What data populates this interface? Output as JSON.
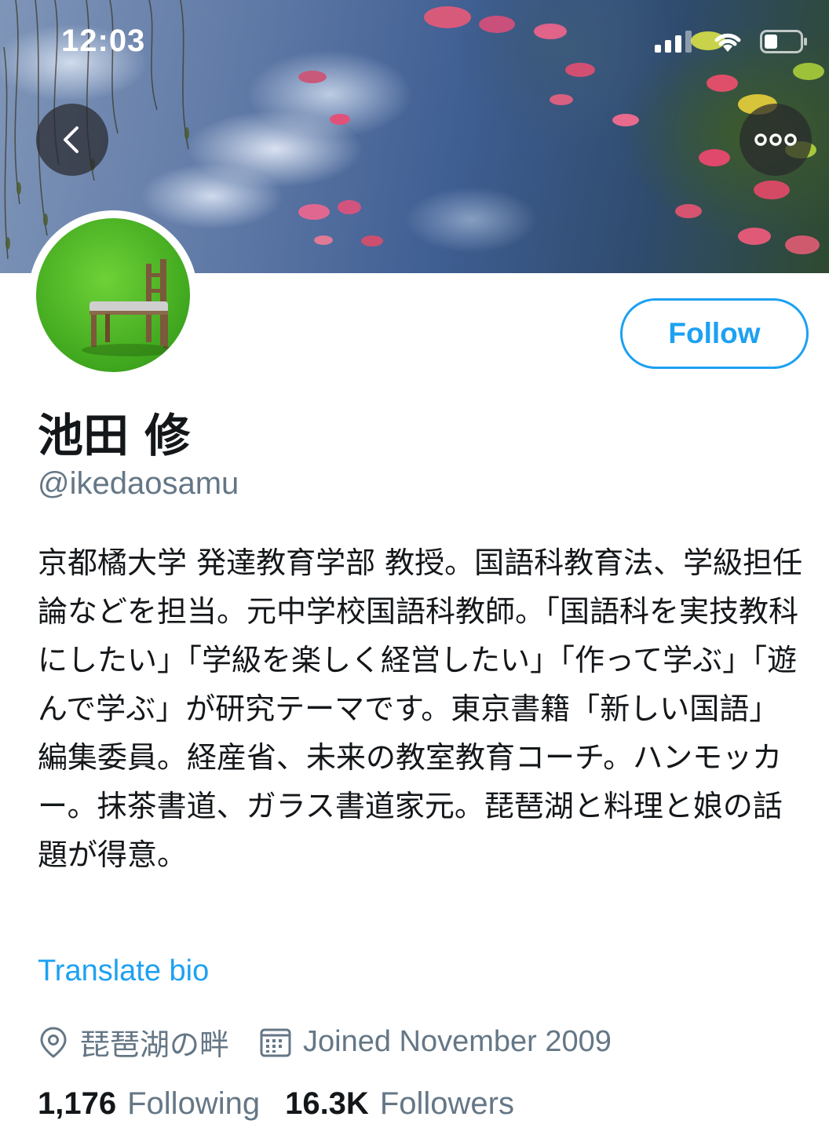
{
  "status_bar": {
    "time": "12:03"
  },
  "header": {
    "back_icon": "chevron-left-icon",
    "more_icon": "ellipsis-icon"
  },
  "profile": {
    "display_name": "池田 修",
    "handle": "@ikedaosamu",
    "follow_label": "Follow",
    "bio": "京都橘大学 発達教育学部 教授。国語科教育法、学級担任論などを担当。元中学校国語科教師。「国語科を実技教科にしたい」「学級を楽しく経営したい」「作って学ぶ」「遊んで学ぶ」が研究テーマです。東京書籍「新しい国語」編集委員。経産省、未来の教室教育コーチ。ハンモッカー。抹茶書道、ガラス書道家元。琵琶湖と料理と娘の話題が得意。",
    "translate_label": "Translate bio",
    "location": "琵琶湖の畔",
    "joined": "Joined November 2009",
    "following_count": "1,176",
    "following_label": "Following",
    "followers_count": "16.3K",
    "followers_label": "Followers"
  },
  "colors": {
    "accent": "#1da1f2",
    "secondary_text": "#657786",
    "primary_text": "#14171a"
  }
}
